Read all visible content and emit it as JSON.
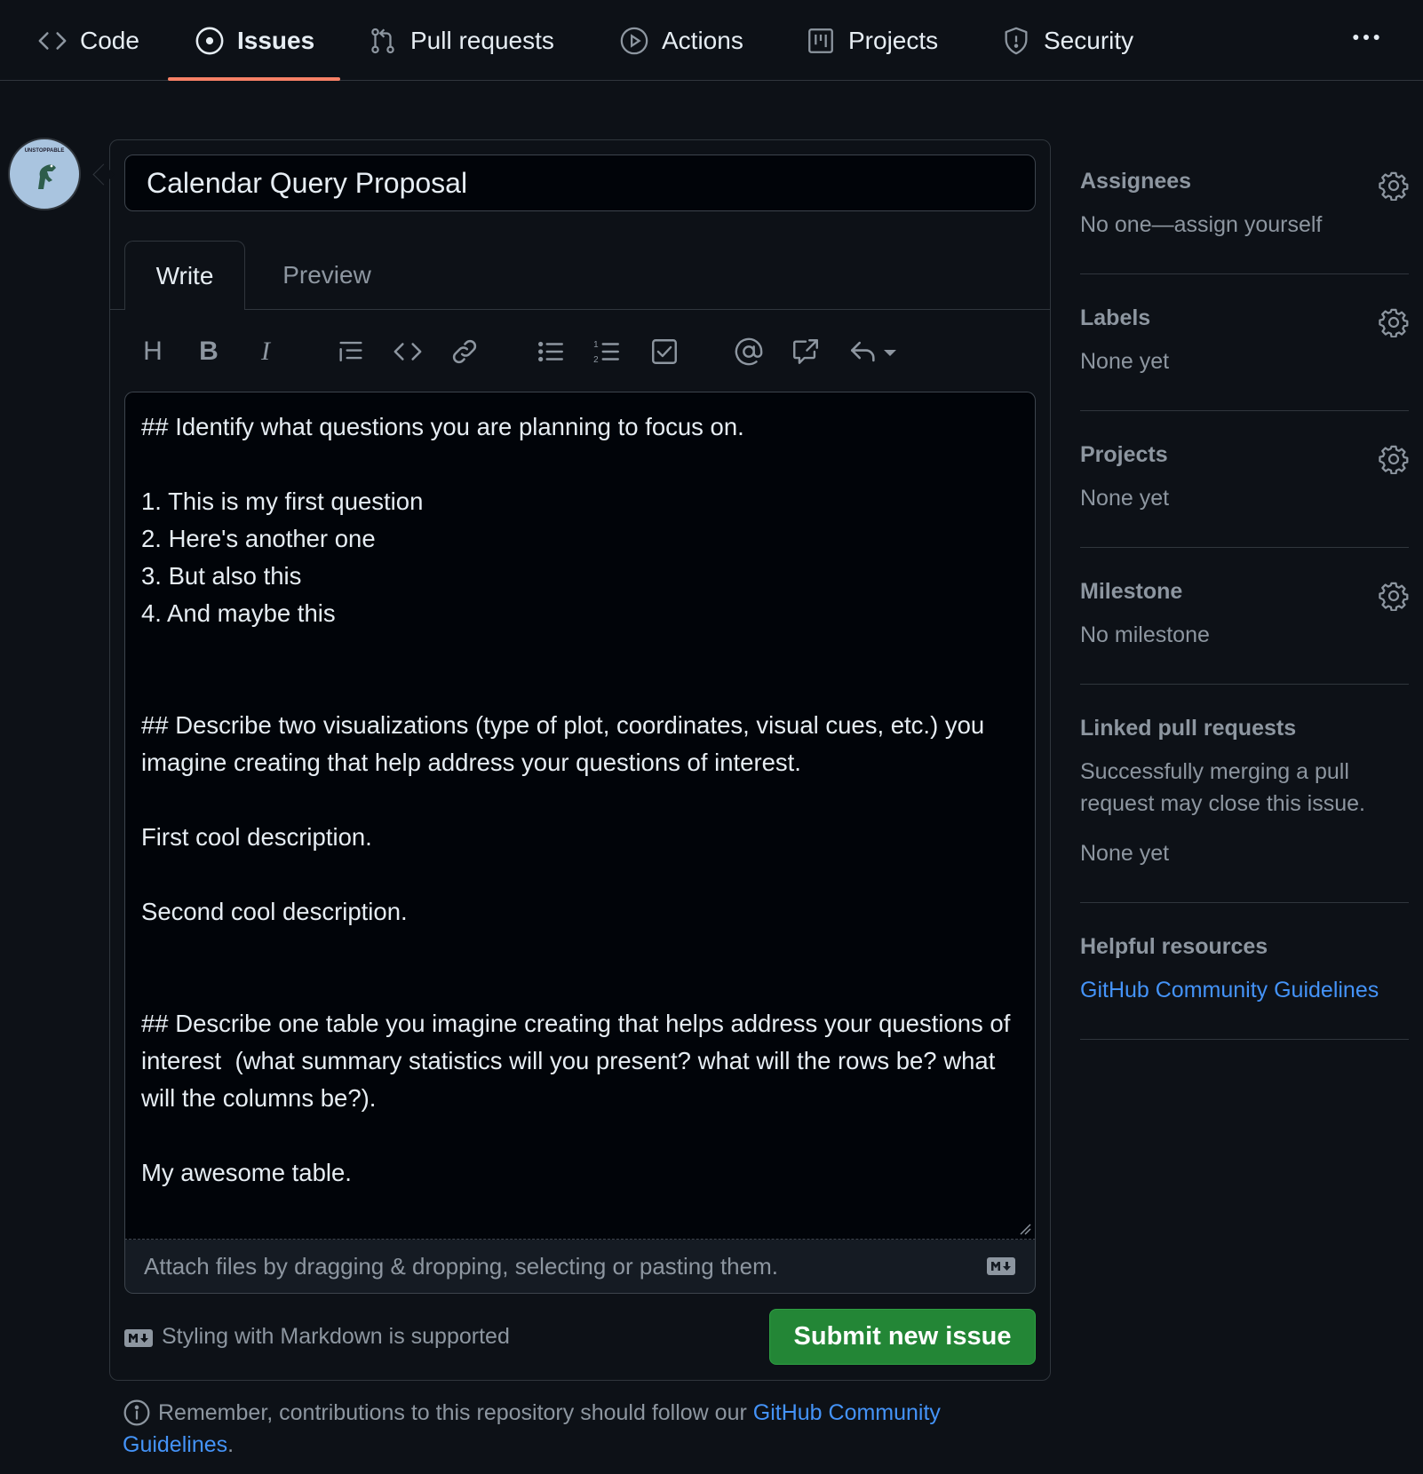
{
  "nav": {
    "tabs": [
      {
        "label": "Code",
        "icon": "code-icon"
      },
      {
        "label": "Issues",
        "icon": "issue-opened-icon"
      },
      {
        "label": "Pull requests",
        "icon": "git-pull-request-icon"
      },
      {
        "label": "Actions",
        "icon": "play-icon"
      },
      {
        "label": "Projects",
        "icon": "table-icon"
      },
      {
        "label": "Security",
        "icon": "shield-icon"
      }
    ],
    "active_tab": "Issues",
    "more_icon": "kebab-horizontal-icon"
  },
  "avatar": {
    "label": "UNSTOPPABLE"
  },
  "issue": {
    "title_value": "Calendar Query Proposal",
    "tab_write": "Write",
    "tab_preview": "Preview",
    "toolbar": [
      "heading-icon",
      "bold-icon",
      "italic-icon",
      "quote-icon",
      "code-icon",
      "link-icon",
      "list-unordered-icon",
      "list-ordered-icon",
      "tasklist-icon",
      "mention-icon",
      "cross-reference-icon",
      "reply-icon"
    ],
    "body": "## Identify what questions you are planning to focus on.\n\n1. This is my first question\n2. Here's another one\n3. But also this\n4. And maybe this\n\n\n## Describe two visualizations (type of plot, coordinates, visual cues, etc.) you imagine creating that help address your questions of interest.\n\nFirst cool description.\n\nSecond cool description.\n\n\n## Describe one table you imagine creating that helps address your questions of interest  (what summary statistics will you present? what will the rows be? what will the columns be?).\n\nMy awesome table.",
    "attach_text": "Attach files by dragging & dropping, selecting or pasting them.",
    "markdown_note": "Styling with Markdown is supported",
    "submit_label": "Submit new issue",
    "remember_text": "Remember, contributions to this repository should follow our ",
    "remember_link": "GitHub Community Guidelines",
    "remember_end": "."
  },
  "sidebar": {
    "assignees": {
      "title": "Assignees",
      "value": "No one—assign yourself"
    },
    "labels": {
      "title": "Labels",
      "value": "None yet"
    },
    "projects": {
      "title": "Projects",
      "value": "None yet"
    },
    "milestone": {
      "title": "Milestone",
      "value": "No milestone"
    },
    "linked_prs": {
      "title": "Linked pull requests",
      "description": "Successfully merging a pull request may close this issue.",
      "value": "None yet"
    },
    "resources": {
      "title": "Helpful resources",
      "link": "GitHub Community Guidelines"
    }
  },
  "colors": {
    "background": "#0d1117",
    "accent_underline": "#f78166",
    "submit_green": "#238636",
    "link_blue": "#4493f8"
  }
}
